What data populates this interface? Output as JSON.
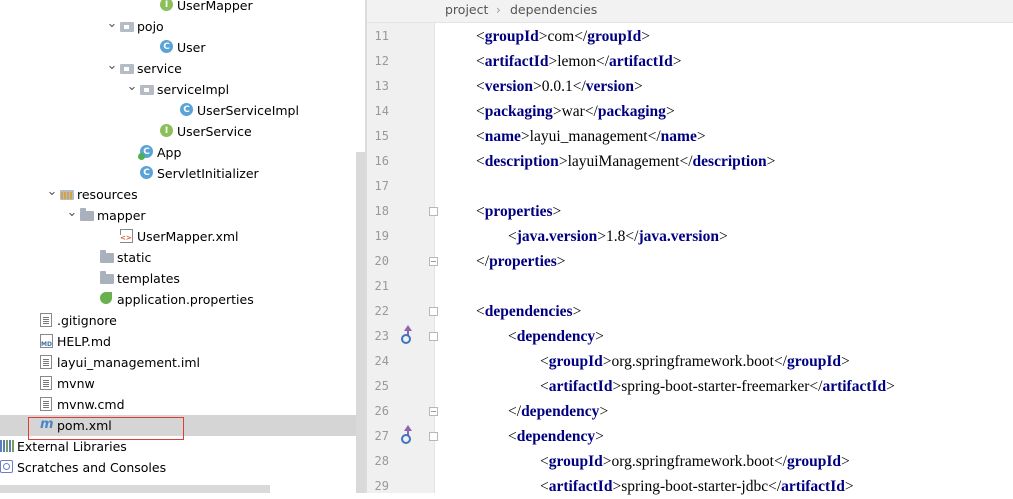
{
  "project_tree": {
    "items": [
      {
        "name": "UserMapper",
        "icon": "interface-icon",
        "indent": 9,
        "arrow": ""
      },
      {
        "name": "pojo",
        "icon": "package-icon",
        "indent": 7,
        "arrow": "expanded"
      },
      {
        "name": "User",
        "icon": "class-icon",
        "indent": 9,
        "arrow": ""
      },
      {
        "name": "service",
        "icon": "package-icon",
        "indent": 7,
        "arrow": "expanded"
      },
      {
        "name": "serviceImpl",
        "icon": "package-icon",
        "indent": 8,
        "arrow": "expanded"
      },
      {
        "name": "UserServiceImpl",
        "icon": "class-icon",
        "indent": 10,
        "arrow": ""
      },
      {
        "name": "UserService",
        "icon": "interface-icon",
        "indent": 9,
        "arrow": ""
      },
      {
        "name": "App",
        "icon": "spring-app-icon",
        "indent": 8,
        "arrow": ""
      },
      {
        "name": "ServletInitializer",
        "icon": "class-icon",
        "indent": 8,
        "arrow": ""
      },
      {
        "name": "resources",
        "icon": "resources-folder-icon",
        "indent": 4,
        "arrow": "expanded"
      },
      {
        "name": "mapper",
        "icon": "folder-icon",
        "indent": 5,
        "arrow": "expanded"
      },
      {
        "name": "UserMapper.xml",
        "icon": "xml-file-icon",
        "indent": 7,
        "arrow": ""
      },
      {
        "name": "static",
        "icon": "folder-icon",
        "indent": 6,
        "arrow": ""
      },
      {
        "name": "templates",
        "icon": "folder-icon",
        "indent": 6,
        "arrow": ""
      },
      {
        "name": "application.properties",
        "icon": "spring-properties-icon",
        "indent": 6,
        "arrow": ""
      },
      {
        "name": ".gitignore",
        "icon": "text-file-icon",
        "indent": 3,
        "arrow": ""
      },
      {
        "name": "HELP.md",
        "icon": "markdown-file-icon",
        "indent": 3,
        "arrow": ""
      },
      {
        "name": "layui_management.iml",
        "icon": "text-file-icon",
        "indent": 3,
        "arrow": ""
      },
      {
        "name": "mvnw",
        "icon": "text-file-icon",
        "indent": 3,
        "arrow": ""
      },
      {
        "name": "mvnw.cmd",
        "icon": "text-file-icon",
        "indent": 3,
        "arrow": ""
      },
      {
        "name": "pom.xml",
        "icon": "maven-icon",
        "indent": 3,
        "arrow": "",
        "selected": true
      },
      {
        "name": "External Libraries",
        "icon": "library-icon",
        "indent": 1,
        "arrow": "collapsed"
      },
      {
        "name": "Scratches and Consoles",
        "icon": "scratches-icon",
        "indent": 1,
        "arrow": "collapsed"
      }
    ]
  },
  "editor": {
    "breadcrumb": [
      "project",
      "dependencies"
    ],
    "lines": [
      {
        "num": "11",
        "indent": 1,
        "code": [
          [
            "b",
            "<"
          ],
          [
            "t",
            "groupId"
          ],
          [
            "b",
            ">"
          ],
          [
            "v",
            "com"
          ],
          [
            "b",
            "</"
          ],
          [
            "t",
            "groupId"
          ],
          [
            "b",
            ">"
          ]
        ]
      },
      {
        "num": "12",
        "indent": 1,
        "code": [
          [
            "b",
            "<"
          ],
          [
            "t",
            "artifactId"
          ],
          [
            "b",
            ">"
          ],
          [
            "v",
            "lemon"
          ],
          [
            "b",
            "</"
          ],
          [
            "t",
            "artifactId"
          ],
          [
            "b",
            ">"
          ]
        ]
      },
      {
        "num": "13",
        "indent": 1,
        "code": [
          [
            "b",
            "<"
          ],
          [
            "t",
            "version"
          ],
          [
            "b",
            ">"
          ],
          [
            "v",
            "0.0.1"
          ],
          [
            "b",
            "</"
          ],
          [
            "t",
            "version"
          ],
          [
            "b",
            ">"
          ]
        ]
      },
      {
        "num": "14",
        "indent": 1,
        "code": [
          [
            "b",
            "<"
          ],
          [
            "t",
            "packaging"
          ],
          [
            "b",
            ">"
          ],
          [
            "v",
            "war"
          ],
          [
            "b",
            "</"
          ],
          [
            "t",
            "packaging"
          ],
          [
            "b",
            ">"
          ]
        ]
      },
      {
        "num": "15",
        "indent": 1,
        "code": [
          [
            "b",
            "<"
          ],
          [
            "t",
            "name"
          ],
          [
            "b",
            ">"
          ],
          [
            "v",
            "layui_management"
          ],
          [
            "b",
            "</"
          ],
          [
            "t",
            "name"
          ],
          [
            "b",
            ">"
          ]
        ]
      },
      {
        "num": "16",
        "indent": 1,
        "code": [
          [
            "b",
            "<"
          ],
          [
            "t",
            "description"
          ],
          [
            "b",
            ">"
          ],
          [
            "v",
            "layuiManagement"
          ],
          [
            "b",
            "</"
          ],
          [
            "t",
            "description"
          ],
          [
            "b",
            ">"
          ]
        ]
      },
      {
        "num": "17",
        "indent": 1,
        "code": []
      },
      {
        "num": "18",
        "indent": 1,
        "code": [
          [
            "b",
            "<"
          ],
          [
            "t",
            "properties"
          ],
          [
            "b",
            ">"
          ]
        ],
        "fold": "start"
      },
      {
        "num": "19",
        "indent": 2,
        "code": [
          [
            "b",
            "<"
          ],
          [
            "t",
            "java.version"
          ],
          [
            "b",
            ">"
          ],
          [
            "v",
            "1.8"
          ],
          [
            "b",
            "</"
          ],
          [
            "t",
            "java.version"
          ],
          [
            "b",
            ">"
          ]
        ]
      },
      {
        "num": "20",
        "indent": 1,
        "code": [
          [
            "b",
            "</"
          ],
          [
            "t",
            "properties"
          ],
          [
            "b",
            ">"
          ]
        ],
        "fold": "end"
      },
      {
        "num": "21",
        "indent": 1,
        "code": []
      },
      {
        "num": "22",
        "indent": 1,
        "code": [
          [
            "b",
            "<"
          ],
          [
            "t",
            "dependencies"
          ],
          [
            "b",
            ">"
          ]
        ],
        "fold": "start"
      },
      {
        "num": "23",
        "indent": 2,
        "code": [
          [
            "b",
            "<"
          ],
          [
            "t",
            "dependency"
          ],
          [
            "b",
            ">"
          ]
        ],
        "fold": "start",
        "maven": true
      },
      {
        "num": "24",
        "indent": 3,
        "code": [
          [
            "b",
            "<"
          ],
          [
            "t",
            "groupId"
          ],
          [
            "b",
            ">"
          ],
          [
            "v",
            "org.springframework.boot"
          ],
          [
            "b",
            "</"
          ],
          [
            "t",
            "groupId"
          ],
          [
            "b",
            ">"
          ]
        ]
      },
      {
        "num": "25",
        "indent": 3,
        "code": [
          [
            "b",
            "<"
          ],
          [
            "t",
            "artifactId"
          ],
          [
            "b",
            ">"
          ],
          [
            "v",
            "spring-boot-starter-freemarker"
          ],
          [
            "b",
            "</"
          ],
          [
            "t",
            "artifactId"
          ],
          [
            "b",
            ">"
          ]
        ]
      },
      {
        "num": "26",
        "indent": 2,
        "code": [
          [
            "b",
            "</"
          ],
          [
            "t",
            "dependency"
          ],
          [
            "b",
            ">"
          ]
        ],
        "fold": "end"
      },
      {
        "num": "27",
        "indent": 2,
        "code": [
          [
            "b",
            "<"
          ],
          [
            "t",
            "dependency"
          ],
          [
            "b",
            ">"
          ]
        ],
        "fold": "start",
        "maven": true
      },
      {
        "num": "28",
        "indent": 3,
        "code": [
          [
            "b",
            "<"
          ],
          [
            "t",
            "groupId"
          ],
          [
            "b",
            ">"
          ],
          [
            "v",
            "org.springframework.boot"
          ],
          [
            "b",
            "</"
          ],
          [
            "t",
            "groupId"
          ],
          [
            "b",
            ">"
          ]
        ]
      },
      {
        "num": "29",
        "indent": 3,
        "code": [
          [
            "b",
            "<"
          ],
          [
            "t",
            "artifactId"
          ],
          [
            "b",
            ">"
          ],
          [
            "v",
            "spring-boot-starter-jdbc"
          ],
          [
            "b",
            "</"
          ],
          [
            "t",
            "artifactId"
          ],
          [
            "b",
            ">"
          ]
        ]
      }
    ]
  }
}
